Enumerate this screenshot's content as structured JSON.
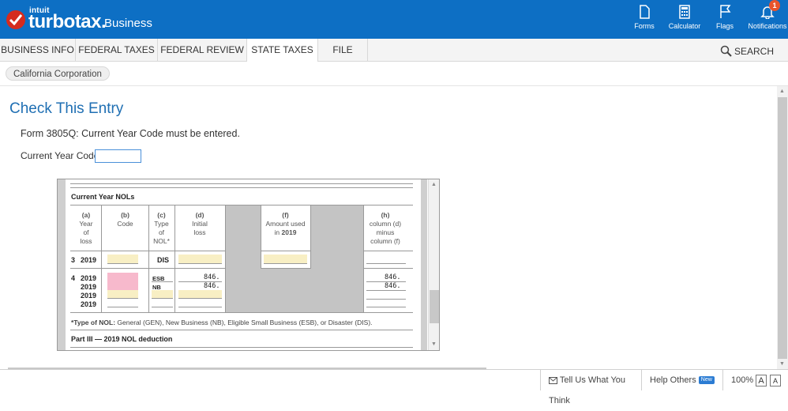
{
  "header": {
    "brand_small": "intuit",
    "brand_main": "turbotax.",
    "brand_sub": "Business",
    "tools": [
      {
        "label": "Forms",
        "icon": "forms-icon"
      },
      {
        "label": "Calculator",
        "icon": "calculator-icon"
      },
      {
        "label": "Flags",
        "icon": "flag-icon"
      },
      {
        "label": "Notifications",
        "icon": "bell-icon"
      }
    ],
    "notification_count": "1"
  },
  "nav": {
    "tabs": [
      {
        "label": "BUSINESS INFO"
      },
      {
        "label": "FEDERAL TAXES"
      },
      {
        "label": "FEDERAL REVIEW"
      },
      {
        "label": "STATE TAXES",
        "active": true
      },
      {
        "label": "FILE"
      }
    ],
    "search_label": "SEARCH"
  },
  "breadcrumb": "California Corporation",
  "main": {
    "title": "Check This Entry",
    "message": "Form 3805Q: Current Year Code must be entered.",
    "code_label": "Current Year Code",
    "code_value": ""
  },
  "form": {
    "section_title": "Current Year NOLs",
    "columns": [
      {
        "key": "(a)",
        "label": "Year\nof\nloss"
      },
      {
        "key": "(b)",
        "label": "Code"
      },
      {
        "key": "(c)",
        "label": "Type\nof\nNOL*"
      },
      {
        "key": "(d)",
        "label": "Initial\nloss"
      },
      {
        "key": "(f)",
        "label": "Amount used\nin",
        "label_bold": "2019"
      },
      {
        "key": "(h)",
        "label": "column (d)\nminus\ncolumn (f)"
      }
    ],
    "row3": {
      "num": "3",
      "year": "2019",
      "type": "DIS"
    },
    "row4": {
      "num": "4",
      "years": [
        "2019",
        "2019",
        "2019",
        "2019"
      ],
      "types": [
        "ESB",
        "NB"
      ],
      "initial_loss": [
        "846.",
        "846."
      ],
      "col_h": [
        "846.",
        "846."
      ]
    },
    "footnote_bold": "*Type of NOL:",
    "footnote": "General (GEN), New Business (NB), Eligible Small Business (ESB), or Disaster (DIS).",
    "part_title": "Part III — 2019 NOL deduction"
  },
  "status_bar": {
    "feedback": "Tell Us What You Think",
    "help": "Help Others",
    "help_badge": "New",
    "zoom": "100%",
    "font_large": "A",
    "font_small": "A"
  },
  "colors": {
    "header_bg": "#0d6fc4",
    "logo_red": "#d52b1e",
    "title_blue": "#1f6fb3",
    "field_yellow": "#f8efc4",
    "field_pink": "#f7b9cc"
  }
}
